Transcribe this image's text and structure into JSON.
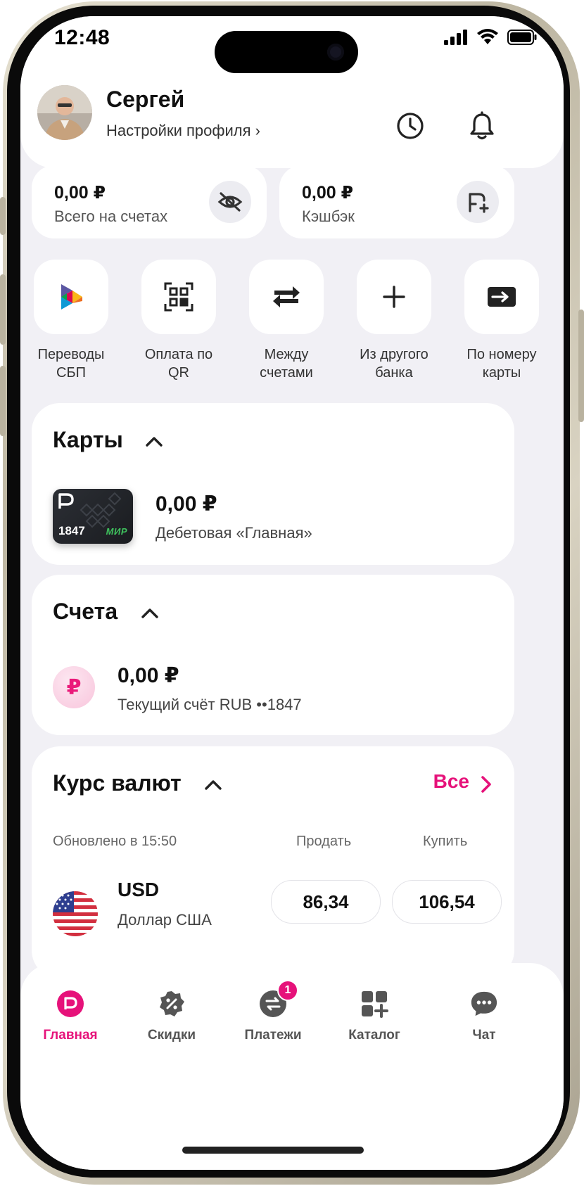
{
  "status_bar": {
    "time": "12:48"
  },
  "profile": {
    "name": "Сергей",
    "settings_link": "Настройки профиля ›"
  },
  "summary": [
    {
      "amount": "0,00 ₽",
      "label": "Всего на счетах",
      "icon": "eye-off-icon"
    },
    {
      "amount": "0,00 ₽",
      "label": "Кэшбэк",
      "icon": "cashback-plus-icon"
    }
  ],
  "quick_actions": [
    {
      "label": "Переводы\nСБП",
      "icon": "sbp-icon"
    },
    {
      "label": "Оплата по\nQR",
      "icon": "qr-icon"
    },
    {
      "label": "Между\nсчетами",
      "icon": "transfer-arrows-icon"
    },
    {
      "label": "Из другого\nбанка",
      "icon": "plus-icon"
    },
    {
      "label": "По номеру\nкарты",
      "icon": "card-arrow-icon"
    }
  ],
  "cards_section": {
    "title": "Карты",
    "card": {
      "number": "1847",
      "brand": "МИР",
      "amount": "0,00 ₽",
      "name": "Дебетовая «Главная»"
    }
  },
  "accounts_section": {
    "title": "Счета",
    "account": {
      "symbol": "₽",
      "amount": "0,00 ₽",
      "name": "Текущий счёт RUB ••1847"
    }
  },
  "rates_section": {
    "title": "Курс валют",
    "all_link": "Все",
    "updated": "Обновлено в 15:50",
    "sell_header": "Продать",
    "buy_header": "Купить",
    "rows": [
      {
        "code": "USD",
        "name": "Доллар США",
        "sell": "86,34",
        "buy": "106,54"
      }
    ]
  },
  "tab_bar": {
    "items": [
      {
        "label": "Главная",
        "icon": "home-icon",
        "active": true
      },
      {
        "label": "Скидки",
        "icon": "discount-icon"
      },
      {
        "label": "Платежи",
        "icon": "payments-icon",
        "badge": "1"
      },
      {
        "label": "Каталог",
        "icon": "catalog-icon"
      },
      {
        "label": "Чат",
        "icon": "chat-icon"
      }
    ]
  },
  "colors": {
    "accent": "#e6127a",
    "background": "#f1f0f5",
    "card": "#ffffff"
  }
}
